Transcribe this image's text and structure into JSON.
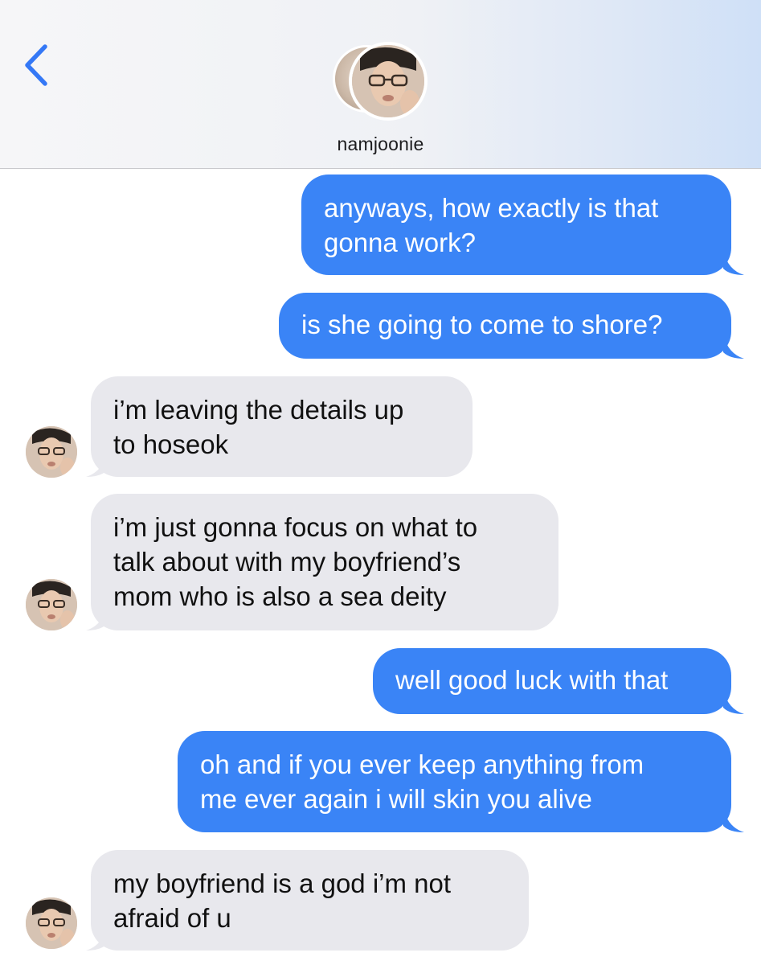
{
  "header": {
    "contact_name": "namjoonie",
    "back_icon": "chevron-left-icon",
    "accent_color": "#3478f6"
  },
  "messages": [
    {
      "direction": "outgoing",
      "text": "anyways, how exactly is that\ngonna work?"
    },
    {
      "direction": "outgoing",
      "text": "is she going to come to shore?"
    },
    {
      "direction": "incoming",
      "text": "i’m leaving the details up\nto hoseok"
    },
    {
      "direction": "incoming",
      "text": "i’m just gonna focus on what to\ntalk about with my boyfriend’s\nmom who is also a sea deity"
    },
    {
      "direction": "outgoing",
      "text": "well good luck with that"
    },
    {
      "direction": "outgoing",
      "text": "oh and if you ever keep anything from\nme ever again i will skin you alive"
    },
    {
      "direction": "incoming",
      "text": "my boyfriend is a god i’m not\nafraid of u"
    }
  ],
  "colors": {
    "outgoing_bubble": "#3a84f6",
    "incoming_bubble": "#e8e8ed"
  }
}
